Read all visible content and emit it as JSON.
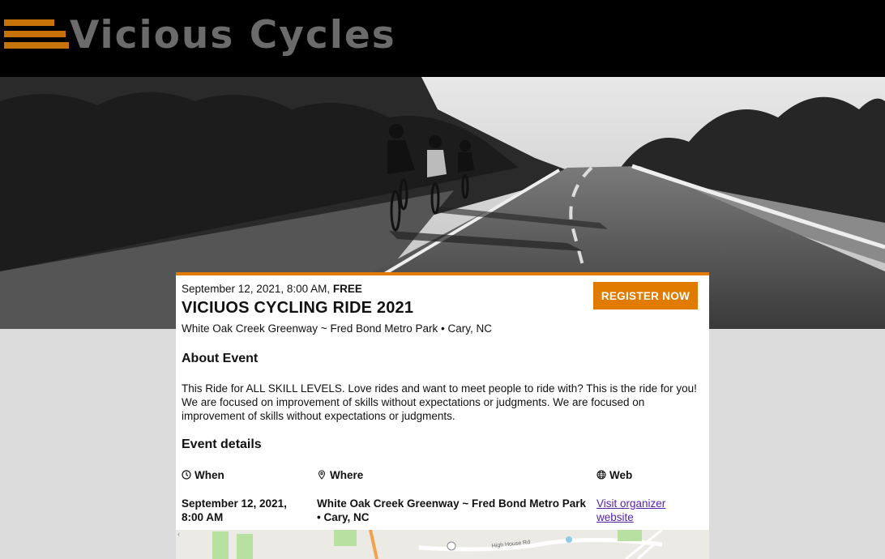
{
  "header": {
    "logo_text": "Vicious Cycles"
  },
  "event": {
    "date_time": "September 12, 2021, 8:00 AM,",
    "price": "FREE",
    "title": "VICIUOS CYCLING RIDE 2021",
    "location": "White Oak Creek Greenway ~ Fred Bond Metro Park • Cary, NC",
    "register_label": "REGISTER NOW"
  },
  "about": {
    "heading": "About Event",
    "text": "This Ride for ALL SKILL LEVELS. Love rides and want to meet people to ride with? This is the ride for you! We are focused on improvement of skills without expectations or judgments. We are focused on improvement of skills without expectations or judgments."
  },
  "details": {
    "heading": "Event details",
    "when_label": "When",
    "when_value": "September 12, 2021, 8:00 AM",
    "where_label": "Where",
    "where_value": "White Oak Creek Greenway ~ Fred Bond Metro Park • Cary, NC",
    "web_label": "Web",
    "web_link": "Visit organizer website"
  },
  "map": {
    "road_label": "High House Rd"
  },
  "colors": {
    "accent": "#e07b00",
    "header_bg": "#000000",
    "logo_text": "#6b6b6b",
    "page_bg": "#dcdcdc",
    "link": "#5522aa"
  },
  "icons": {
    "when": "clock-icon",
    "where": "map-pin-icon",
    "web": "globe-icon"
  }
}
